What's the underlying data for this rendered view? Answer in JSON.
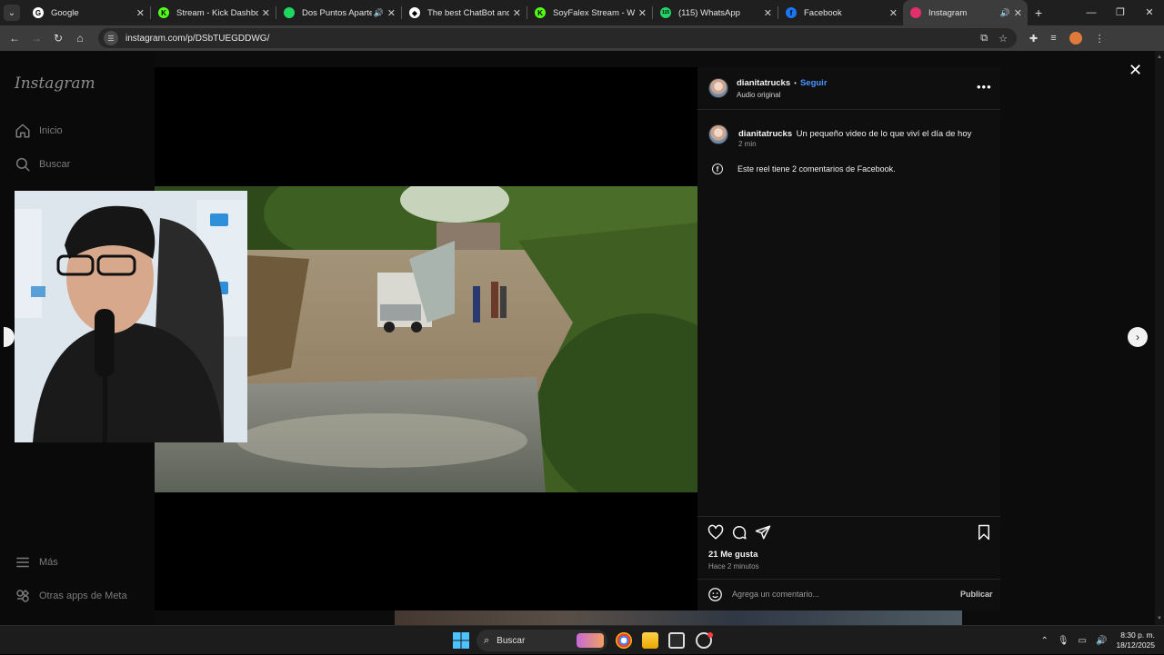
{
  "browser": {
    "tabs": [
      {
        "title": "Google",
        "favicon_color": "#ffffff",
        "favicon_glyph": "G"
      },
      {
        "title": "Stream - Kick Dashboard",
        "favicon_color": "#53fc18",
        "favicon_glyph": "K"
      },
      {
        "title": "Dos Puntos Aparte - C",
        "favicon_color": "#1ed760",
        "favicon_glyph": "",
        "audio": true
      },
      {
        "title": "The best ChatBot and We",
        "favicon_color": "#ffffff",
        "favicon_glyph": "◆"
      },
      {
        "title": "SoyFalex Stream - Watch",
        "favicon_color": "#53fc18",
        "favicon_glyph": "K"
      },
      {
        "title": "(115) WhatsApp",
        "favicon_color": "#25d366",
        "favicon_glyph": "115"
      },
      {
        "title": "Facebook",
        "favicon_color": "#1877f2",
        "favicon_glyph": "f"
      },
      {
        "title": "Instagram",
        "favicon_color": "#e1306c",
        "favicon_glyph": "",
        "audio": true,
        "active": true
      }
    ],
    "url": "instagram.com/p/DSbTUEGDDWG/"
  },
  "sidebar": {
    "logo": "Instagram",
    "items": [
      {
        "label": "Inicio",
        "icon": "home-icon"
      },
      {
        "label": "Buscar",
        "icon": "search-icon"
      },
      {
        "label": "Más",
        "icon": "menu-icon"
      },
      {
        "label": "Otras apps de Meta",
        "icon": "meta-apps-icon"
      }
    ]
  },
  "post": {
    "username": "dianitatrucks",
    "follow_label": "Seguir",
    "separator": "•",
    "audio": "Audio original",
    "caption_user": "dianitatrucks",
    "caption_text": "Un pequeño video de lo que viví el día de hoy",
    "caption_age": "2 min",
    "facebook_note": "Este reel tiene 2 comentarios de Facebook.",
    "likes": "21 Me gusta",
    "posted": "Hace 2 minutos",
    "comment_placeholder": "Agrega un comentario...",
    "publish_label": "Publicar"
  },
  "taskbar": {
    "search_label": "Buscar",
    "time": "8:30 p. m.",
    "date": "18/12/2025"
  },
  "colors": {
    "link_blue": "#4a96ff",
    "page_bg": "#0c0c0c",
    "panel_bg": "#0f0f0f"
  }
}
